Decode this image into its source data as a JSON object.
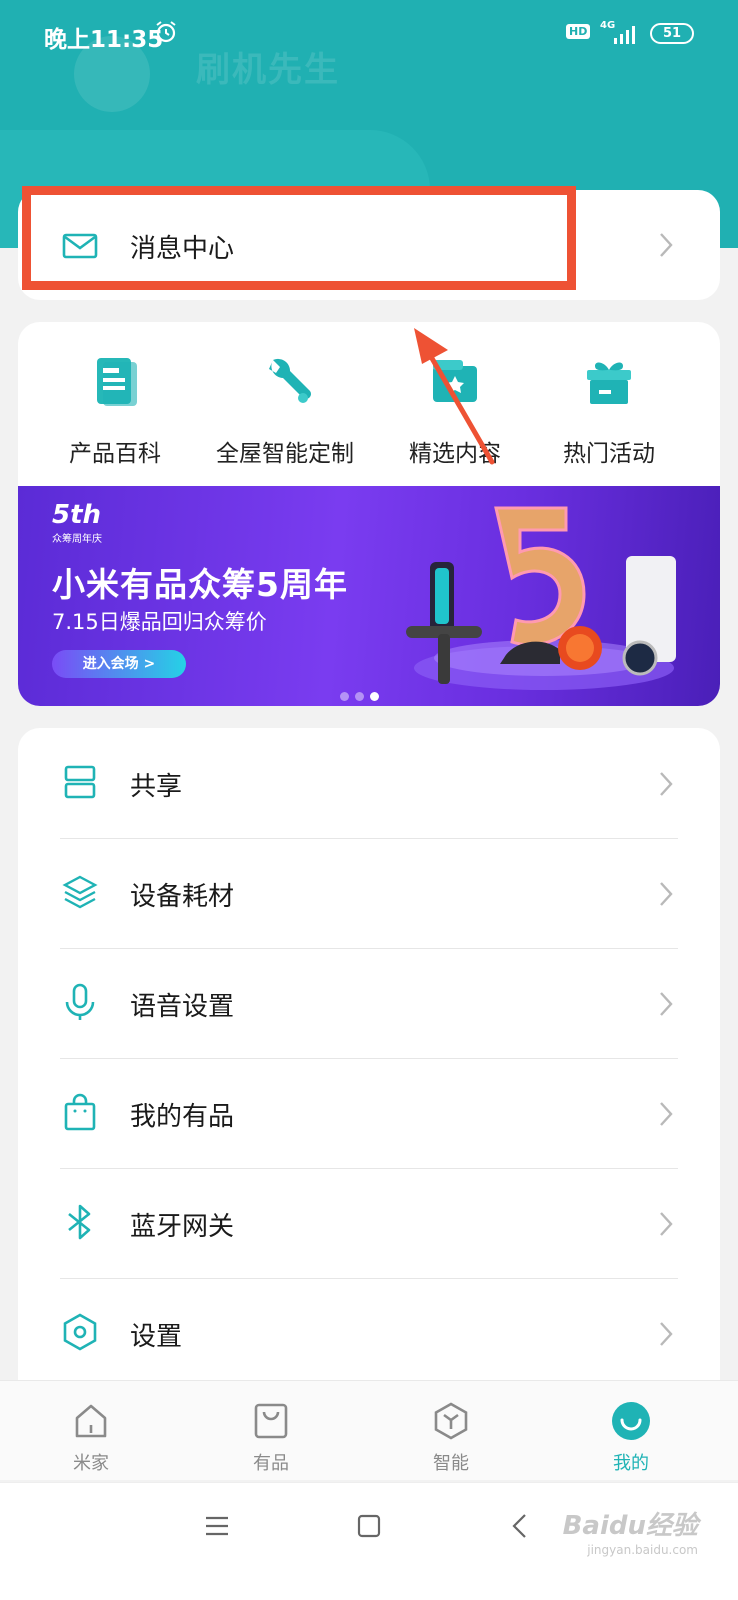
{
  "status_bar": {
    "time": "晚上11:35",
    "hd": "HD",
    "network": "4G",
    "battery": "51"
  },
  "message_center": {
    "label": "消息中心"
  },
  "quick_actions": [
    {
      "label": "产品百科",
      "icon": "product-wiki-icon"
    },
    {
      "label": "全屋智能定制",
      "icon": "wrench-icon"
    },
    {
      "label": "精选内容",
      "icon": "featured-content-icon"
    },
    {
      "label": "热门活动",
      "icon": "gift-icon"
    }
  ],
  "banner": {
    "logo": "5th",
    "logo_sub": "众筹周年庆",
    "title": "小米有品众筹5周年",
    "subtitle": "7.15日爆品回归众筹价",
    "button": "进入会场 >",
    "page_count": 3,
    "active_page": 3
  },
  "menu": [
    {
      "label": "共享",
      "icon": "share-icon"
    },
    {
      "label": "设备耗材",
      "icon": "layers-icon"
    },
    {
      "label": "语音设置",
      "icon": "microphone-icon"
    },
    {
      "label": "我的有品",
      "icon": "shopping-bag-icon"
    },
    {
      "label": "蓝牙网关",
      "icon": "bluetooth-icon"
    },
    {
      "label": "设置",
      "icon": "settings-icon"
    }
  ],
  "tabs": [
    {
      "label": "米家",
      "icon": "home-icon"
    },
    {
      "label": "有品",
      "icon": "bag-icon"
    },
    {
      "label": "智能",
      "icon": "smart-cube-icon"
    },
    {
      "label": "我的",
      "icon": "profile-smile-icon",
      "active": true
    }
  ],
  "watermark": {
    "text": "Baidu经验",
    "sub": "jingyan.baidu.com"
  },
  "colors": {
    "brand": "#20b0b2",
    "accent": "#1fb3b5",
    "highlight": "#ee5234"
  }
}
